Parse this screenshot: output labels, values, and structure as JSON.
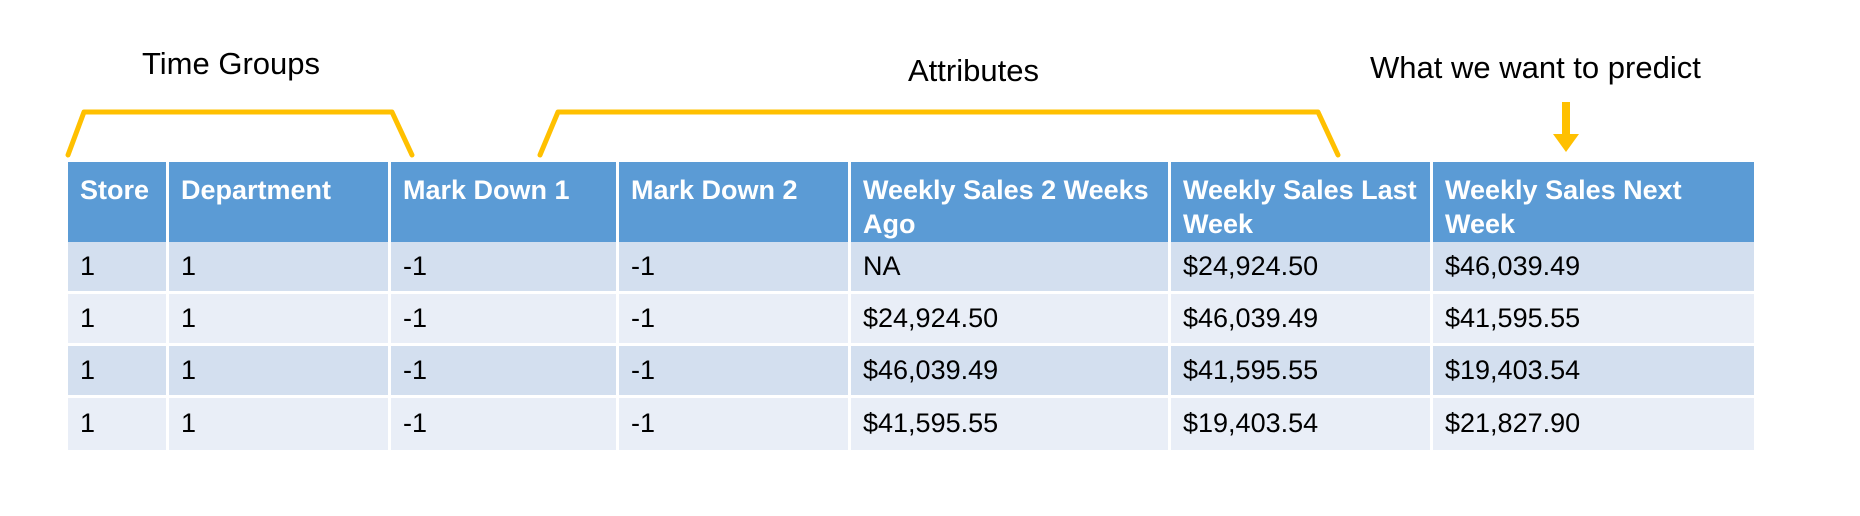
{
  "annotations": {
    "time_groups": "Time Groups",
    "attributes": "Attributes",
    "predict": "What we want to predict",
    "bracket_color": "#FFC000",
    "arrow_color": "#FFC000"
  },
  "table": {
    "header_bg": "#5B9BD5",
    "header_fg": "#FFFFFF",
    "row_odd_bg": "#D3DFEF",
    "row_even_bg": "#E9EEF7",
    "columns": [
      "Store",
      "Department",
      "Mark Down 1",
      "Mark Down 2",
      "Weekly Sales 2 Weeks Ago",
      "Weekly Sales Last Week",
      "Weekly Sales Next Week"
    ],
    "rows": [
      [
        "1",
        "1",
        "-1",
        "-1",
        "NA",
        "$24,924.50",
        "$46,039.49"
      ],
      [
        "1",
        "1",
        "-1",
        "-1",
        "$24,924.50",
        "$46,039.49",
        "$41,595.55"
      ],
      [
        "1",
        "1",
        "-1",
        "-1",
        "$46,039.49",
        "$41,595.55",
        "$19,403.54"
      ],
      [
        "1",
        "1",
        "-1",
        "-1",
        "$41,595.55",
        "$19,403.54",
        "$21,827.90"
      ]
    ]
  }
}
